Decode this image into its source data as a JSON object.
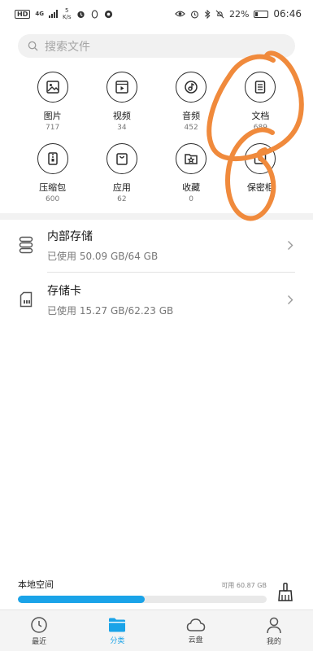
{
  "statusbar": {
    "hd": "HD",
    "network": "4G",
    "speed_value": "5",
    "speed_unit": "K/s",
    "battery_pct": "22%",
    "battery_level": 0.22,
    "time": "06:46"
  },
  "search": {
    "placeholder": "搜索文件"
  },
  "categories": [
    {
      "label": "图片",
      "count": "717"
    },
    {
      "label": "视频",
      "count": "34"
    },
    {
      "label": "音频",
      "count": "452"
    },
    {
      "label": "文档",
      "count": "689"
    },
    {
      "label": "压缩包",
      "count": "600"
    },
    {
      "label": "应用",
      "count": "62"
    },
    {
      "label": "收藏",
      "count": "0"
    },
    {
      "label": "保密柜",
      "count": ""
    }
  ],
  "storage": [
    {
      "title": "内部存储",
      "subtitle": "已使用 50.09 GB/64 GB"
    },
    {
      "title": "存储卡",
      "subtitle": "已使用 15.27 GB/62.23 GB"
    }
  ],
  "local_space": {
    "title": "本地空间",
    "available": "可用 60.87 GB",
    "used_fraction": 0.51
  },
  "nav": [
    {
      "label": "最近"
    },
    {
      "label": "分类",
      "active": true
    },
    {
      "label": "云盘"
    },
    {
      "label": "我的"
    }
  ],
  "colors": {
    "accent": "#1aa3e8",
    "scribble": "#f08a3c"
  }
}
